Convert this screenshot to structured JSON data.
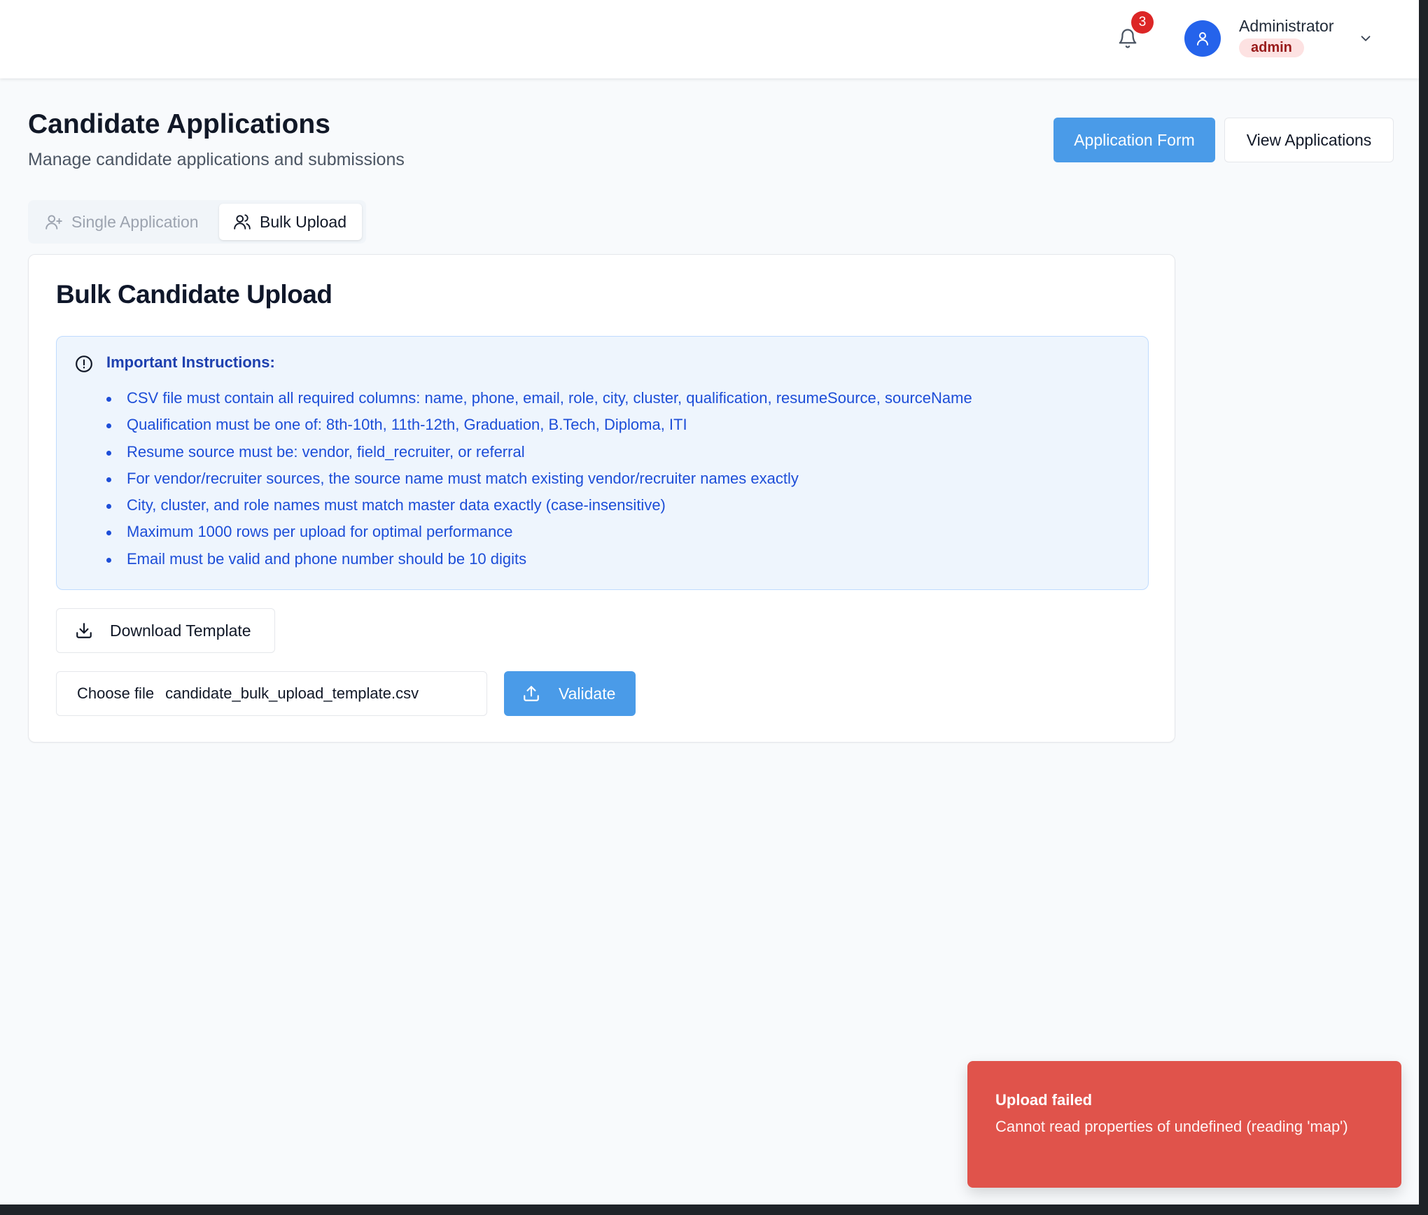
{
  "header": {
    "notification_count": "3",
    "user_name": "Administrator",
    "user_role": "admin"
  },
  "page": {
    "title": "Candidate Applications",
    "subtitle": "Manage candidate applications and submissions",
    "application_form_label": "Application Form",
    "view_applications_label": "View Applications"
  },
  "tabs": [
    {
      "label": "Single Application",
      "active": false,
      "icon": "user-plus-icon"
    },
    {
      "label": "Bulk Upload",
      "active": true,
      "icon": "users-icon"
    }
  ],
  "bulk_upload": {
    "title": "Bulk Candidate Upload",
    "instructions_heading": "Important Instructions:",
    "instructions": [
      "CSV file must contain all required columns: name, phone, email, role, city, cluster, qualification, resumeSource, sourceName",
      "Qualification must be one of: 8th-10th, 11th-12th, Graduation, B.Tech, Diploma, ITI",
      "Resume source must be: vendor, field_recruiter, or referral",
      "For vendor/recruiter sources, the source name must match existing vendor/recruiter names exactly",
      "City, cluster, and role names must match master data exactly (case-insensitive)",
      "Maximum 1000 rows per upload for optimal performance",
      "Email must be valid and phone number should be 10 digits"
    ],
    "download_template_label": "Download Template",
    "choose_file_label": "Choose file",
    "selected_file_name": "candidate_bulk_upload_template.csv",
    "validate_label": "Validate"
  },
  "toast": {
    "title": "Upload failed",
    "message": "Cannot read properties of undefined (reading 'map')"
  },
  "colors": {
    "primary_button": "#4a9be8",
    "avatar": "#2563eb",
    "badge": "#dc2626",
    "instructions_text": "#1d4ed8",
    "instructions_bg": "#eef5fd",
    "toast_bg": "#e0534b",
    "role_badge_bg": "#fde2e2",
    "role_badge_text": "#991b1b"
  }
}
